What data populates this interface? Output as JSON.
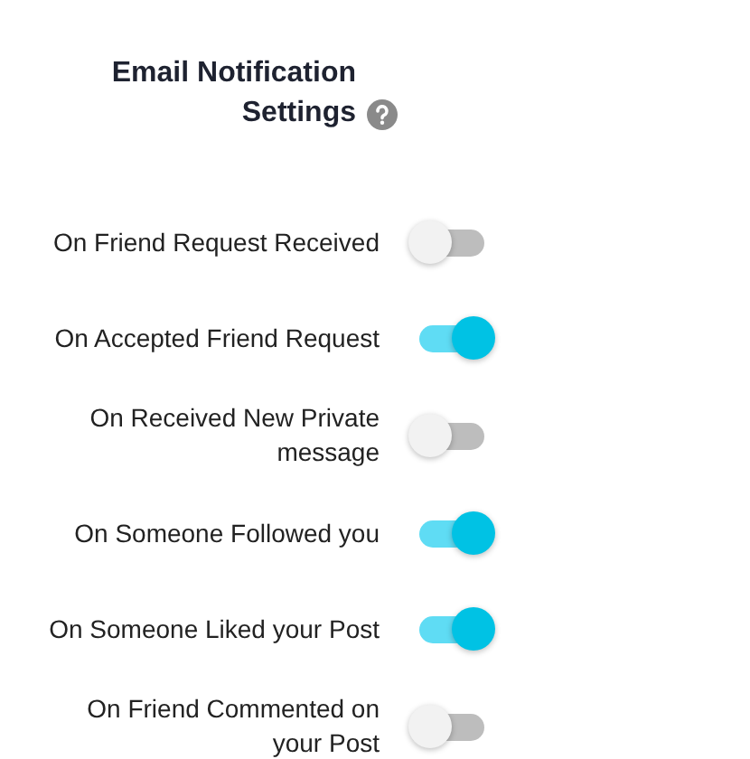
{
  "title": "Email Notification\nSettings",
  "settings": [
    {
      "label": "On Friend Request Received",
      "on": false
    },
    {
      "label": "On Accepted Friend Request",
      "on": true
    },
    {
      "label": "On Received New Private\nmessage",
      "on": false
    },
    {
      "label": "On Someone Followed you",
      "on": true
    },
    {
      "label": "On Someone Liked your Post",
      "on": true
    },
    {
      "label": "On Friend Commented on\nyour Post",
      "on": false
    }
  ]
}
